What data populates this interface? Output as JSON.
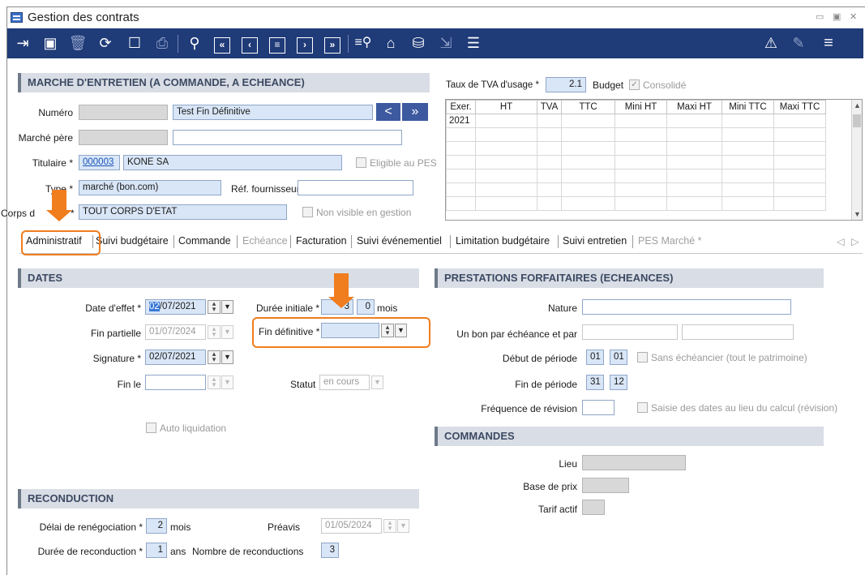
{
  "window": {
    "title": "Gestion des contrats",
    "controls": [
      "▭",
      "▣",
      "✕"
    ]
  },
  "toolbar": {
    "icons": [
      "enter-icon",
      "save-icon",
      "delete-icon",
      "refresh-icon",
      "calendar-icon",
      "print-icon",
      "search-icon",
      "first-record-icon",
      "previous-record-icon",
      "list-icon",
      "next-record-icon",
      "last-record-icon",
      "filter-search-icon",
      "home-icon",
      "database-icon",
      "export-icon",
      "list-view-icon",
      "warning-icon",
      "edit-icon",
      "menu-icon"
    ]
  },
  "header": {
    "section_title": "MARCHE D'ENTRETIEN (A COMMANDE, A ECHEANCE)",
    "numero_label": "Numéro",
    "numero_value": "Test Fin Définitive",
    "marche_pere_label": "Marché père",
    "titulaire_label": "Titulaire *",
    "titulaire_code": "000003",
    "titulaire_name": "KONE SA",
    "eligible_pes_label": "Eligible au PES",
    "type_label": "Type *",
    "type_value": "marché (bon.com)",
    "ref_fournisseur_label": "Réf. fournisseur",
    "corps_label_a": "Corps d",
    "corps_label_b": "*",
    "corps_value": "TOUT CORPS D'ETAT",
    "non_visible_label": "Non visible en gestion",
    "nav_prev": "<",
    "nav_next": "»"
  },
  "tva": {
    "label": "Taux de TVA d'usage *",
    "value": "2.1",
    "budget_label": "Budget",
    "consolide_label": "Consolidé"
  },
  "grid": {
    "columns": [
      "Exer.",
      "HT",
      "TVA",
      "TTC",
      "Mini HT",
      "Maxi HT",
      "Mini TTC",
      "Maxi TTC"
    ],
    "rows": [
      [
        "2021",
        "",
        "",
        "",
        "",
        "",
        "",
        ""
      ]
    ]
  },
  "tabs": [
    {
      "label": "Administratif",
      "disabled": false
    },
    {
      "label": "Suivi budgétaire",
      "disabled": false
    },
    {
      "label": "Commande",
      "disabled": false
    },
    {
      "label": "Echéance",
      "disabled": true
    },
    {
      "label": "Facturation",
      "disabled": false
    },
    {
      "label": "Suivi événementiel",
      "disabled": false
    },
    {
      "label": "Limitation budgétaire",
      "disabled": false
    },
    {
      "label": "Suivi entretien",
      "disabled": false
    },
    {
      "label": "PES Marché *",
      "disabled": true
    }
  ],
  "tab_nav": {
    "left": "◁",
    "right": "▷"
  },
  "dates": {
    "section_title": "DATES",
    "date_effet_label": "Date d'effet *",
    "date_effet_sel": "02",
    "date_effet_rest": "/07/2021",
    "fin_partielle_label": "Fin partielle",
    "fin_partielle_value": "01/07/2024",
    "signature_label": "Signature *",
    "signature_value": "02/07/2021",
    "fin_le_label": "Fin le",
    "duree_initiale_label": "Durée initiale *",
    "duree_years": "3",
    "duree_months": "0",
    "duree_unit": "mois",
    "fin_definitive_label": "Fin définitive *",
    "statut_label": "Statut",
    "statut_value": "en cours",
    "auto_liquidation_label": "Auto liquidation"
  },
  "reconduction": {
    "section_title": "RECONDUCTION",
    "delai_label": "Délai de renégociation *",
    "delai_value": "2",
    "delai_unit": "mois",
    "preavis_label": "Préavis",
    "preavis_value": "01/05/2024",
    "duree_label": "Durée de reconduction *",
    "duree_value": "1",
    "duree_unit": "ans",
    "nombre_label": "Nombre de reconductions",
    "nombre_value": "3"
  },
  "prestations": {
    "section_title": "PRESTATIONS FORFAITAIRES (ECHEANCES)",
    "nature_label": "Nature",
    "bon_label": "Un bon par échéance et par",
    "debut_label": "Début de période",
    "debut_day": "01",
    "debut_month": "01",
    "sans_echeancier_label": "Sans échéancier (tout le patrimoine)",
    "fin_label": "Fin de période",
    "fin_day": "31",
    "fin_month": "12",
    "frequence_label": "Fréquence de révision",
    "saisie_label": "Saisie des dates au lieu du calcul (révision)"
  },
  "commandes": {
    "section_title": "COMMANDES",
    "lieu_label": "Lieu",
    "base_prix_label": "Base de prix",
    "tarif_actif_label": "Tarif actif"
  },
  "colors": {
    "accent": "#f07d1e",
    "toolbar": "#1f3b78",
    "required_field": "#d9e6f7"
  }
}
